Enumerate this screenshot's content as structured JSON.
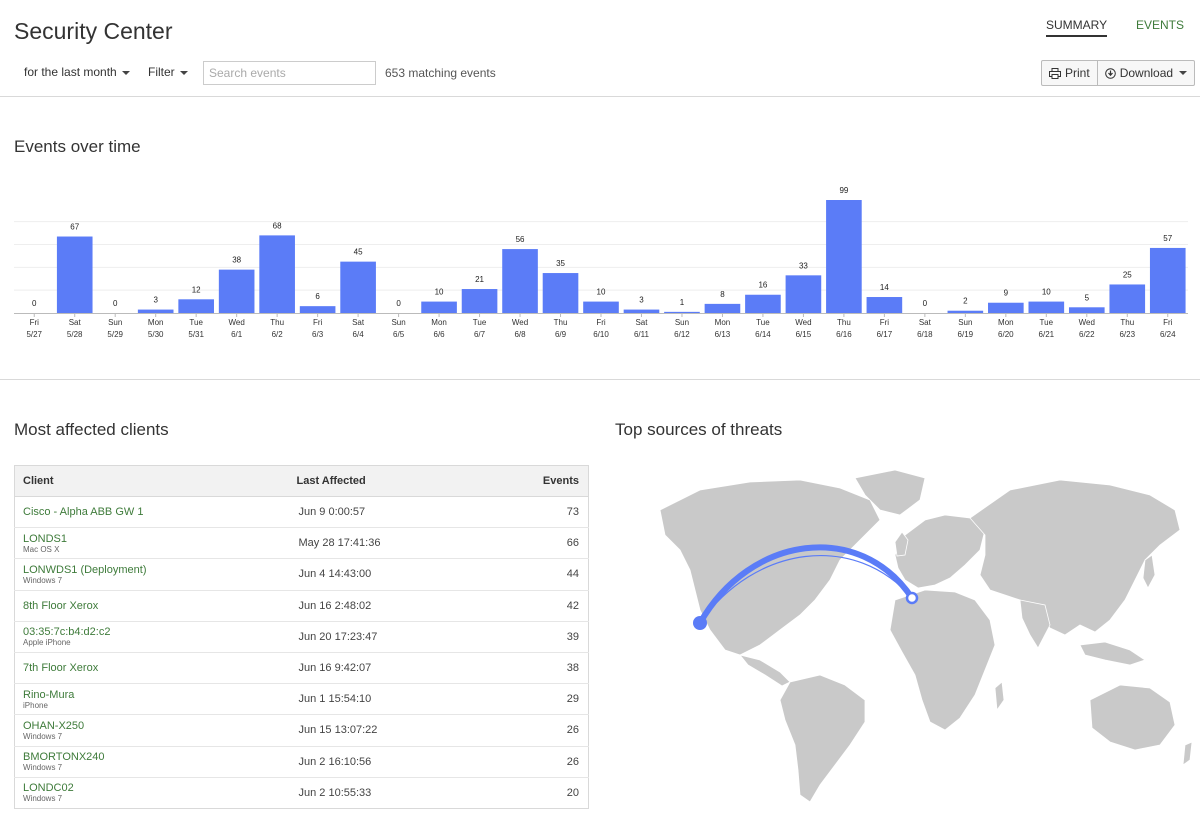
{
  "header": {
    "title": "Security Center",
    "tabs": [
      {
        "label": "SUMMARY"
      },
      {
        "label": "EVENTS"
      }
    ],
    "time_filter": "for the last month",
    "filter_label": "Filter",
    "search_placeholder": "Search events",
    "match_count": "653 matching events",
    "print_label": "Print",
    "download_label": "Download"
  },
  "events_section": {
    "title": "Events over time"
  },
  "chart_data": {
    "type": "bar",
    "days": [
      "Fri",
      "Sat",
      "Sun",
      "Mon",
      "Tue",
      "Wed",
      "Thu",
      "Fri",
      "Sat",
      "Sun",
      "Mon",
      "Tue",
      "Wed",
      "Thu",
      "Fri",
      "Sat",
      "Sun",
      "Mon",
      "Tue",
      "Wed",
      "Thu",
      "Fri",
      "Sat",
      "Sun",
      "Mon",
      "Tue",
      "Wed",
      "Thu",
      "Fri"
    ],
    "categories": [
      "5/27",
      "5/28",
      "5/29",
      "5/30",
      "5/31",
      "6/1",
      "6/2",
      "6/3",
      "6/4",
      "6/5",
      "6/6",
      "6/7",
      "6/8",
      "6/9",
      "6/10",
      "6/11",
      "6/12",
      "6/13",
      "6/14",
      "6/15",
      "6/16",
      "6/17",
      "6/18",
      "6/19",
      "6/20",
      "6/21",
      "6/22",
      "6/23",
      "6/24"
    ],
    "values": [
      0,
      67,
      0,
      3,
      12,
      38,
      68,
      6,
      45,
      0,
      10,
      21,
      56,
      35,
      10,
      3,
      1,
      8,
      16,
      33,
      99,
      14,
      0,
      2,
      9,
      10,
      5,
      25,
      57
    ],
    "ylim": [
      0,
      99
    ],
    "color": "#5b7cf7",
    "grid": true
  },
  "clients_section": {
    "title": "Most affected clients",
    "columns": [
      "Client",
      "Last Affected",
      "Events"
    ],
    "rows": [
      {
        "name": "Cisco - Alpha ABB GW 1",
        "sub": "",
        "last": "Jun 9 0:00:57",
        "events": "73"
      },
      {
        "name": "LONDS1",
        "sub": "Mac OS X",
        "last": "May 28 17:41:36",
        "events": "66"
      },
      {
        "name": "LONWDS1 (Deployment)",
        "sub": "Windows 7",
        "last": "Jun 4 14:43:00",
        "events": "44"
      },
      {
        "name": "8th Floor Xerox",
        "sub": "",
        "last": "Jun 16 2:48:02",
        "events": "42"
      },
      {
        "name": "03:35:7c:b4:d2:c2",
        "sub": "Apple iPhone",
        "last": "Jun 20 17:23:47",
        "events": "39"
      },
      {
        "name": "7th Floor Xerox",
        "sub": "",
        "last": "Jun 16 9:42:07",
        "events": "38"
      },
      {
        "name": "Rino-Mura",
        "sub": "iPhone",
        "last": "Jun 1 15:54:10",
        "events": "29"
      },
      {
        "name": "OHAN-X250",
        "sub": "Windows 7",
        "last": "Jun 15 13:07:22",
        "events": "26"
      },
      {
        "name": "BMORTONX240",
        "sub": "Windows 7",
        "last": "Jun 2 16:10:56",
        "events": "26"
      },
      {
        "name": "LONDC02",
        "sub": "Windows 7",
        "last": "Jun 2 10:55:33",
        "events": "20"
      }
    ]
  },
  "threats_section": {
    "title": "Top sources of threats"
  },
  "colors": {
    "accent": "#5b7cf7",
    "link": "#3e7b3a",
    "map_land": "#c9c9c9"
  }
}
